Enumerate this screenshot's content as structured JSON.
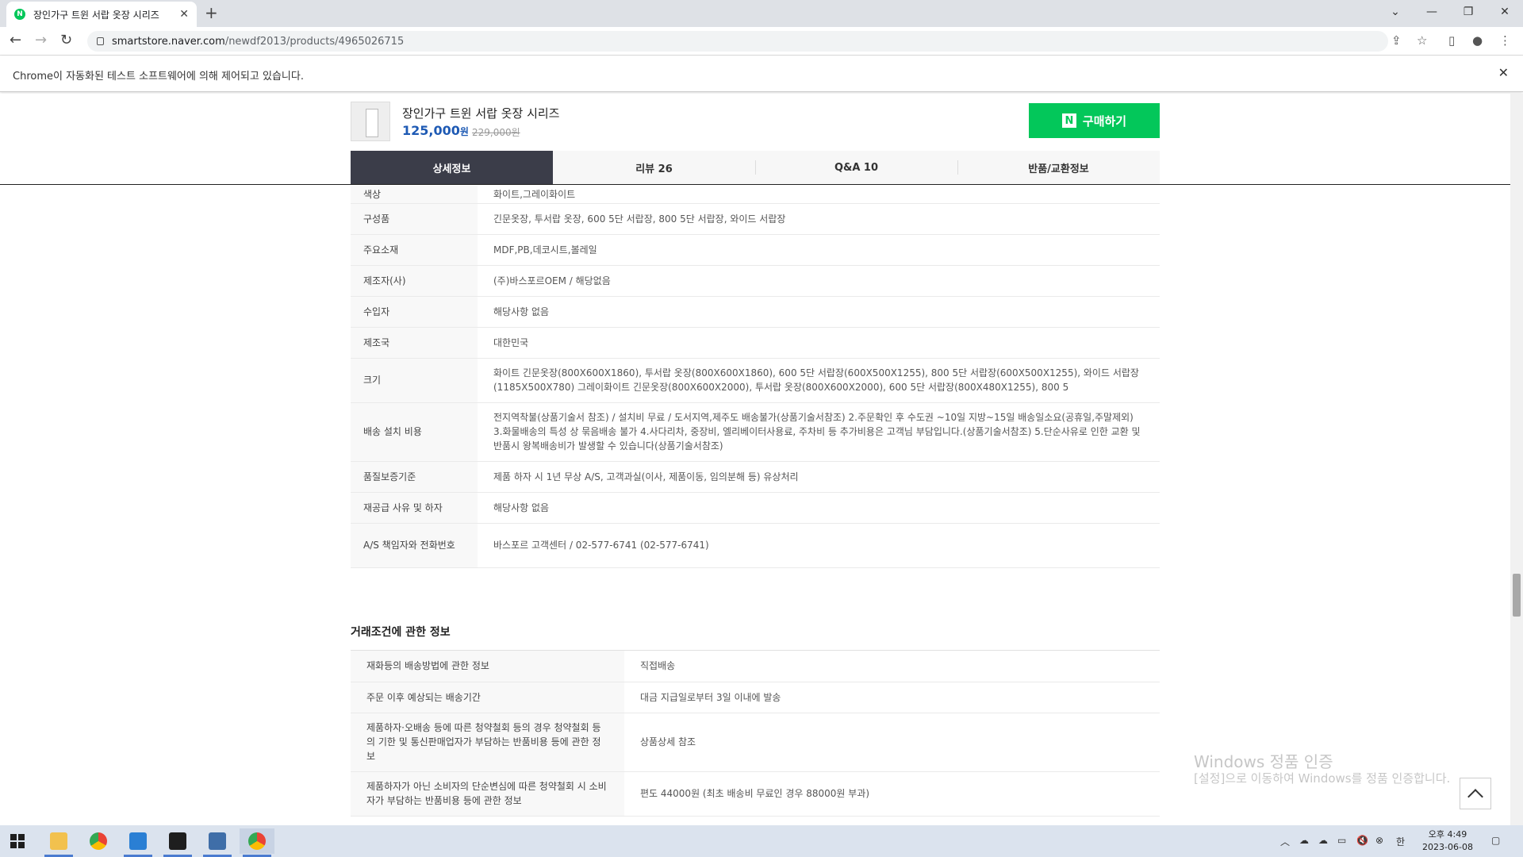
{
  "browser": {
    "tab_title": "장인가구 트윈 서랍 옷장 시리즈",
    "url_host": "smartstore.naver.com",
    "url_path": "/newdf2013/products/4965026715",
    "automation_notice": "Chrome이 자동화된 테스트 소프트웨어에 의해 제어되고 있습니다."
  },
  "product": {
    "name": "장인가구 트윈 서랍 옷장 시리즈",
    "price": "125,000",
    "price_unit": "원",
    "original_price": "229,000원",
    "buy_label": "구매하기",
    "buy_logo": "N"
  },
  "tabs": [
    {
      "label": "상세정보",
      "active": true
    },
    {
      "label": "리뷰 26"
    },
    {
      "label": "Q&A 10"
    },
    {
      "label": "반품/교환정보"
    }
  ],
  "spec_rows": [
    {
      "key": "색상",
      "value": "화이트,그레이화이트"
    },
    {
      "key": "구성품",
      "value": "긴문옷장, 투서랍 옷장, 600 5단 서랍장, 800 5단 서랍장, 와이드 서랍장"
    },
    {
      "key": "주요소재",
      "value": "MDF,PB,데코시트,볼레일"
    },
    {
      "key": "제조자(사)",
      "value": "(주)바스포르OEM / 해당없음"
    },
    {
      "key": "수입자",
      "value": "해당사항 없음"
    },
    {
      "key": "제조국",
      "value": "대한민국"
    },
    {
      "key": "크기",
      "value": "화이트 긴문옷장(800X600X1860), 투서랍 옷장(800X600X1860), 600 5단 서랍장(600X500X1255), 800 5단 서랍장(600X500X1255), 와이드 서랍장(1185X500X780) 그레이화이트 긴문옷장(800X600X2000), 투서랍 옷장(800X600X2000), 600 5단 서랍장(800X480X1255), 800 5"
    },
    {
      "key": "배송 설치 비용",
      "value": "전지역착불(상품기술서 참조) / 설치비 무료 / 도서지역,제주도 배송불가(상품기술서참조) 2.주문확인 후 수도권 ~10일 지방~15일 배송일소요(공휴일,주말제외) 3.화물배송의 특성 상 묶음배송 불가 4.사다리차, 중장비, 엘리베이터사용료, 주차비 등 추가비용은 고객님 부담입니다.(상품기술서참조) 5.단순사유로 인한 교환 및 반품시 왕복배송비가 발생할 수 있습니다(상품기술서참조)"
    },
    {
      "key": "품질보증기준",
      "value": "제품 하자 시 1년 무상 A/S, 고객과실(이사, 제품이동, 임의분해 등) 유상처리"
    },
    {
      "key": "재공급 사유 및 하자",
      "value": "해당사항 없음"
    },
    {
      "key": "A/S 책임자와 전화번호",
      "value": "바스포르 고객센터 / 02-577-6741 (02-577-6741)"
    }
  ],
  "deal_title": "거래조건에 관한 정보",
  "deal_rows": [
    {
      "key": "재화등의 배송방법에 관한 정보",
      "value": "직접배송"
    },
    {
      "key": "주문 이후 예상되는 배송기간",
      "value": "대금 지급일로부터 3일 이내에 발송"
    },
    {
      "key": "제품하자·오배송 등에 따른 청약철회 등의 경우 청약철회 등의 기한 및 통신판매업자가 부담하는 반품비용 등에 관한 정보",
      "value": "상품상세 참조"
    },
    {
      "key": "제품하자가 아닌 소비자의 단순변심에 따른 청약철회 시 소비자가 부담하는 반품비용 등에 관한 정보",
      "value": "편도 44000원 (최초 배송비 무료인 경우 88000원 부과)"
    }
  ],
  "watermark": {
    "line1": "Windows 정품 인증",
    "line2": "[설정]으로 이동하여 Windows를 정품 인증합니다."
  },
  "taskbar": {
    "time": "오후 4:49",
    "date": "2023-06-08",
    "ime": "한"
  },
  "colors": {
    "naver_green": "#03c75a",
    "price_blue": "#1e5ab4",
    "active_tab": "#3b3d49"
  }
}
